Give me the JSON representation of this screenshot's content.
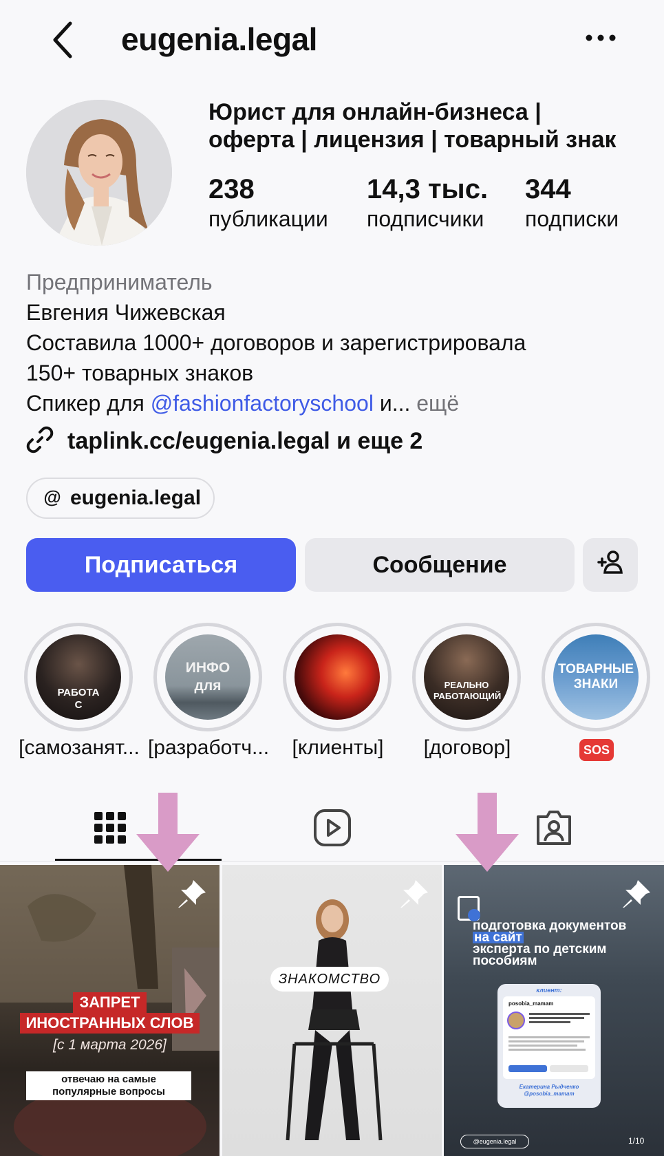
{
  "header": {
    "username": "eugenia.legal"
  },
  "profile": {
    "headline_line1": "Юрист для онлайн-бизнеса |",
    "headline_line2": "оферта | лицензия | товарный знак",
    "stats": [
      {
        "num": "238",
        "label": "публикации"
      },
      {
        "num": "14,3 тыс.",
        "label": "подписчики"
      },
      {
        "num": "344",
        "label": "подписки"
      }
    ]
  },
  "bio": {
    "category": "Предприниматель",
    "name": "Евгения Чижевская",
    "line1": "Составила 1000+ договоров и зарегистрировала",
    "line2": "150+ товарных знаков",
    "speaker_prefix": "Спикер для ",
    "speaker_link": "@fashionfactoryschool",
    "speaker_suffix": " и...",
    "more": " ещё",
    "link": "taplink.cc/eugenia.legal и еще 2",
    "threads": "eugenia.legal"
  },
  "buttons": {
    "follow": "Подписаться",
    "message": "Сообщение"
  },
  "highlights": [
    {
      "cover": "РАБОТА С",
      "caption": "[самозанят..."
    },
    {
      "cover": "ИНФО для",
      "caption": "[разработч..."
    },
    {
      "cover": "",
      "caption": "[клиенты]"
    },
    {
      "cover": "РЕАЛЬНО РАБОТАЮЩИЙ",
      "caption": "[договор]"
    },
    {
      "cover": "ТОВАРНЫЕ ЗНАКИ",
      "caption": "SOS"
    }
  ],
  "posts": [
    {
      "title_line1": "ЗАПРЕТ",
      "title_line2": "ИНОСТРАННЫХ СЛОВ",
      "date": "[с 1 марта 2026]",
      "caption": "отвечаю на самые популярные вопросы"
    },
    {
      "label": "ЗНАКОМСТВО"
    },
    {
      "line1": "подготовка документов",
      "line2": "на сайт",
      "line3": "эксперта по детским",
      "line4": "пособиям",
      "client_label": "клиент:",
      "client_handle": "posobia_mamam",
      "client_name": "Екатерина Рыдченко",
      "client_tag": "@posobia_mamam",
      "watermark": "@eugenia.legal",
      "counter": "1/10"
    }
  ],
  "colors": {
    "accent": "#4a5df0",
    "link": "#3f5be6",
    "arrow": "#d99bc7",
    "post1_banner": "#c62828"
  }
}
